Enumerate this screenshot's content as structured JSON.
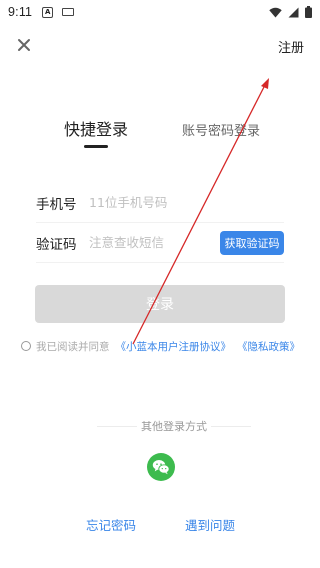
{
  "status_bar": {
    "time": "9:11",
    "a_badge": "A"
  },
  "header": {
    "register_label": "注册"
  },
  "tabs": {
    "quick_login": "快捷登录",
    "password_login": "账号密码登录"
  },
  "form": {
    "phone_label": "手机号",
    "phone_placeholder": "11位手机号码",
    "code_label": "验证码",
    "code_placeholder": "注意查收短信",
    "get_code_label": "获取验证码"
  },
  "login_button": "登录",
  "agreement": {
    "prefix": "我已阅读并同意",
    "user_agreement": "《小蓝本用户注册协议》",
    "privacy_policy": "《隐私政策》"
  },
  "other_login_label": "其他登录方式",
  "bottom": {
    "forgot_password": "忘记密码",
    "have_problem": "遇到问题"
  },
  "colors": {
    "accent": "#3a86e8",
    "login_disabled": "#d9d9d9",
    "wechat": "#3dbb4e",
    "annotation": "#d62828"
  }
}
